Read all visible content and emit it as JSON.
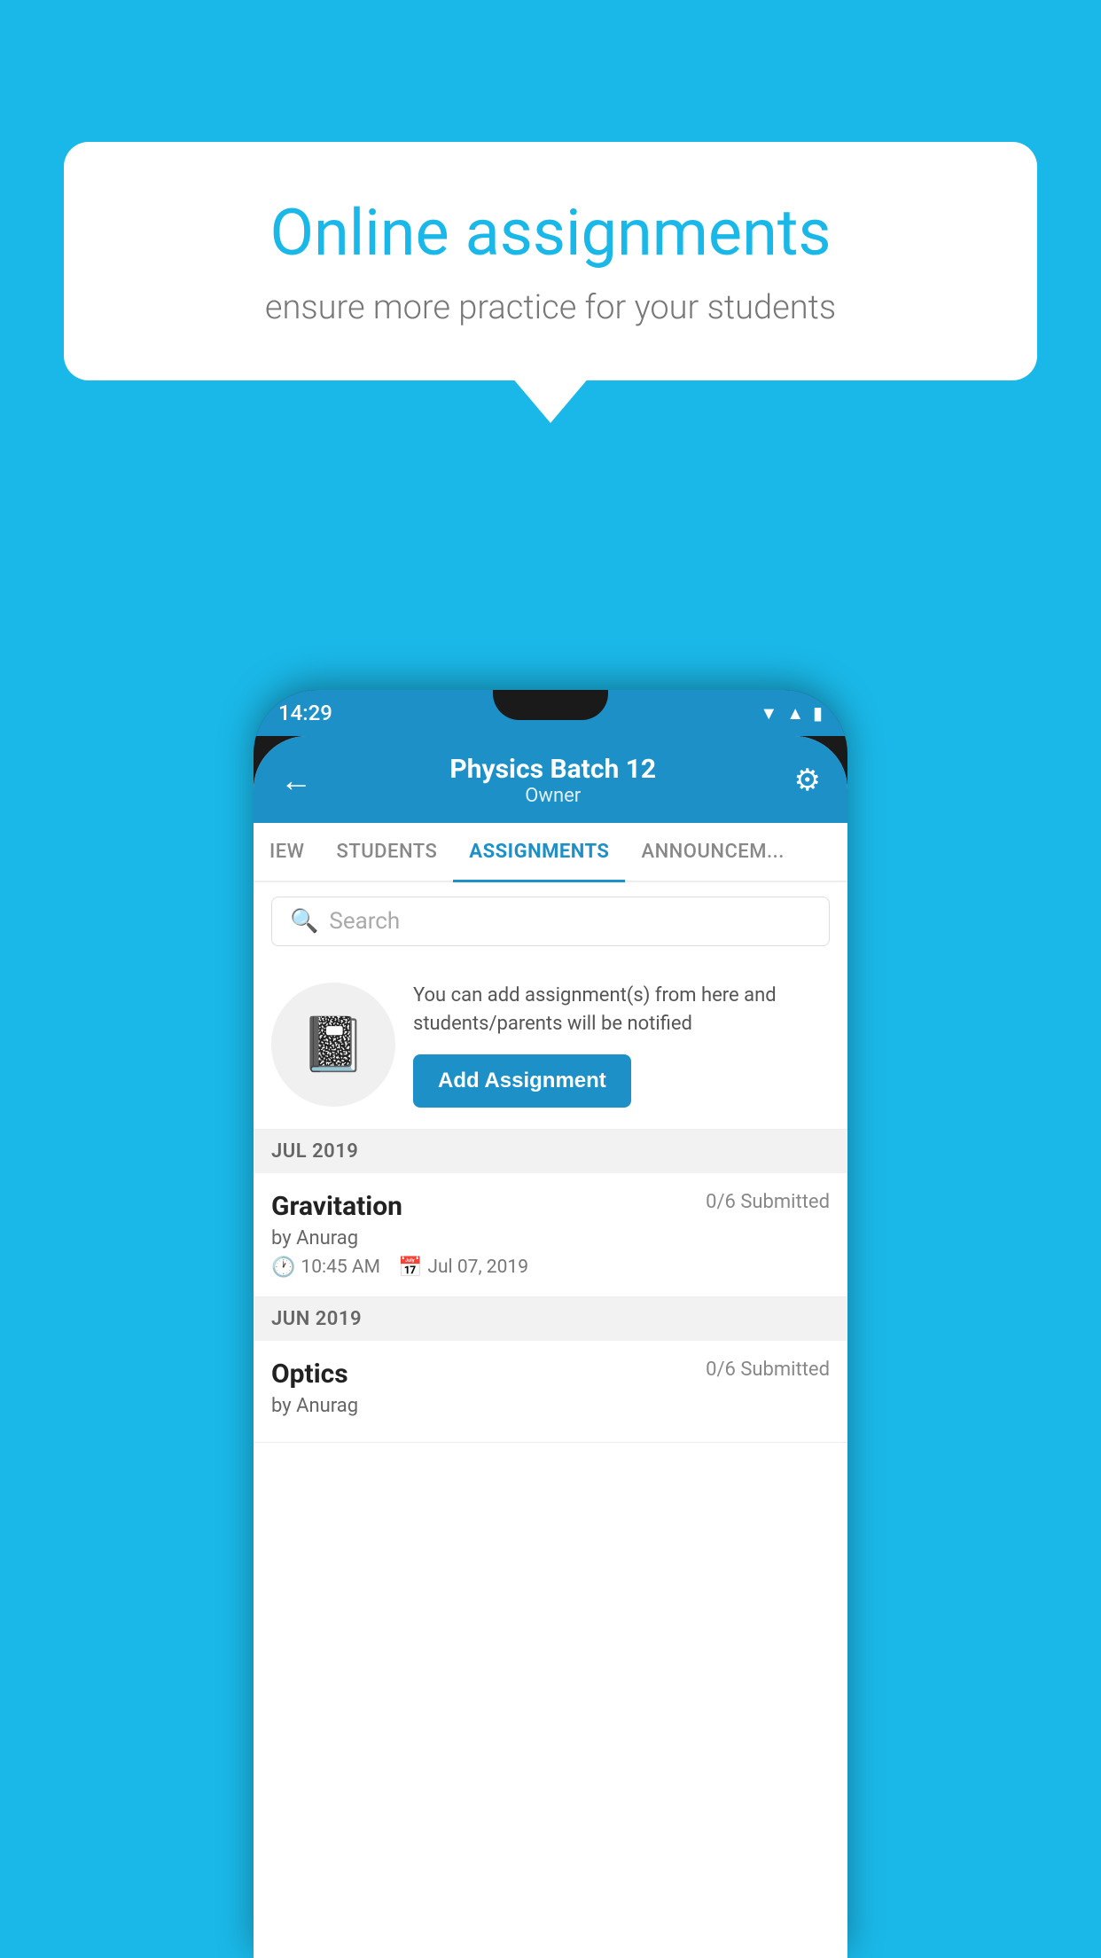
{
  "background_color": "#1ab8e8",
  "speech_bubble": {
    "heading": "Online assignments",
    "subtext": "ensure more practice for your students"
  },
  "phone": {
    "status_bar": {
      "time": "14:29",
      "wifi_icon": "▲",
      "signal_icon": "▲",
      "battery_icon": "▮"
    },
    "header": {
      "title": "Physics Batch 12",
      "subtitle": "Owner",
      "back_icon": "←",
      "settings_icon": "⚙"
    },
    "tabs": [
      {
        "label": "IEW",
        "active": false
      },
      {
        "label": "STUDENTS",
        "active": false
      },
      {
        "label": "ASSIGNMENTS",
        "active": true
      },
      {
        "label": "ANNOUNCEM...",
        "active": false
      }
    ],
    "search": {
      "placeholder": "Search"
    },
    "promo": {
      "description": "You can add assignment(s) from here and students/parents will be notified",
      "button_label": "Add Assignment"
    },
    "assignments": [
      {
        "month": "JUL 2019",
        "items": [
          {
            "name": "Gravitation",
            "submitted": "0/6 Submitted",
            "author": "by Anurag",
            "time": "10:45 AM",
            "date": "Jul 07, 2019"
          }
        ]
      },
      {
        "month": "JUN 2019",
        "items": [
          {
            "name": "Optics",
            "submitted": "0/6 Submitted",
            "author": "by Anurag",
            "time": "",
            "date": ""
          }
        ]
      }
    ]
  }
}
